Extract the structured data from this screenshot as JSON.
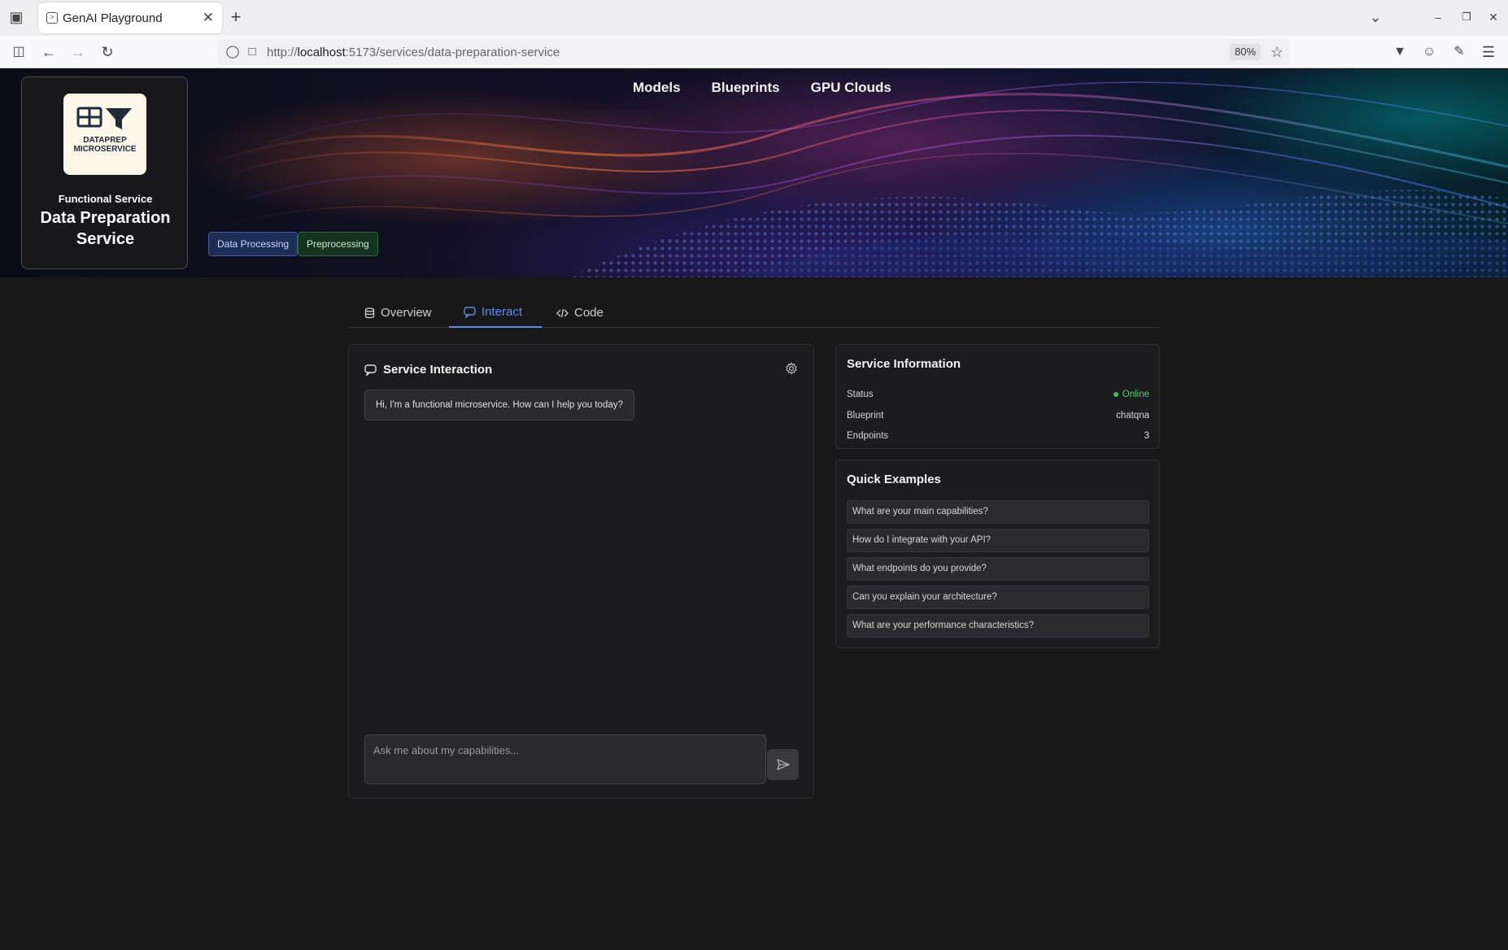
{
  "browser": {
    "tab_title": "GenAI Playground",
    "url_prefix": "http://",
    "url_host": "localhost",
    "url_path": ":5173/services/data-preparation-service",
    "zoom": "80%"
  },
  "nav": {
    "items": [
      "Models",
      "Blueprints",
      "GPU Clouds"
    ]
  },
  "service": {
    "logo_line1": "DATAPREP",
    "logo_line2": "MICROSERVICE",
    "category": "Functional Service",
    "name": "Data Preparation Service",
    "tags": [
      "Data Processing",
      "Preprocessing"
    ]
  },
  "tabs": [
    "Overview",
    "Interact",
    "Code"
  ],
  "chat": {
    "title": "Service Interaction",
    "greeting": "Hi, I'm a functional microservice. How can I help you today?",
    "input_placeholder": "Ask me about my capabilities..."
  },
  "info": {
    "title": "Service Information",
    "rows": [
      {
        "label": "Status",
        "value": "Online"
      },
      {
        "label": "Blueprint",
        "value": "chatqna"
      },
      {
        "label": "Endpoints",
        "value": "3"
      }
    ]
  },
  "examples": {
    "title": "Quick Examples",
    "items": [
      "What are your main capabilities?",
      "How do I integrate with your API?",
      "What endpoints do you provide?",
      "Can you explain your architecture?",
      "What are your performance characteristics?"
    ]
  },
  "colors": {
    "accent": "#5b8def",
    "online": "#4cd46a",
    "background": "#181818"
  }
}
